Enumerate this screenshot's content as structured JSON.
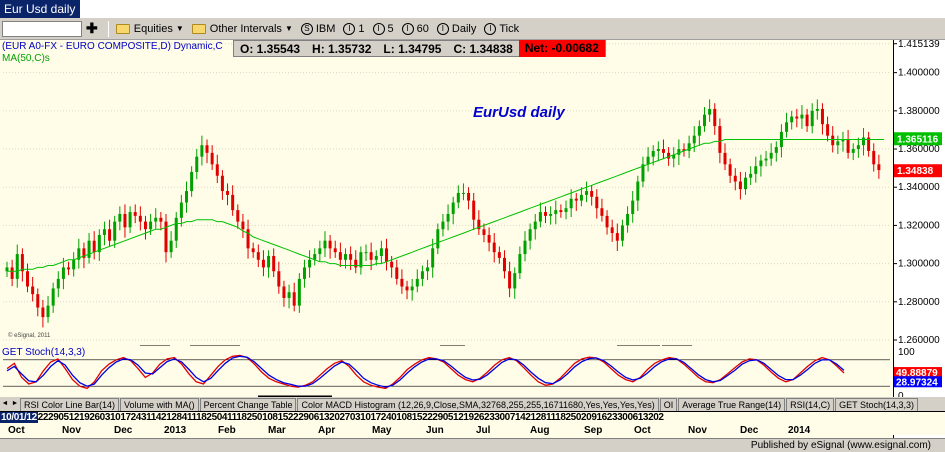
{
  "window": {
    "title": "Eur Usd daily"
  },
  "toolbar": {
    "symbol_placeholder": "",
    "equities_label": "Equities",
    "intervals_label": "Other Intervals",
    "interval_buttons": [
      "IBM",
      "1",
      "5",
      "60",
      "Daily",
      "Tick"
    ]
  },
  "quote": {
    "open": "O: 1.35543",
    "high": "H: 1.35732",
    "low": "L: 1.34795",
    "close": "C: 1.34838",
    "net": "Net: -0.00682"
  },
  "labels": {
    "symbol": "(EUR A0-FX - EURO COMPOSITE,D) Dynamic,C",
    "ma": "MA(50,C)s",
    "chart_title": "EurUsd daily",
    "credit": "© eSignal, 2011",
    "stoch": "GET Stoch(14,3,3)"
  },
  "tabs": [
    "RSI Color Line Bar(14)",
    "Volume with MA()",
    "Percent Change Table",
    "Color MACD Histogram (12,26,9,Close,SMA,32768,255,255,16711680,Yes,Yes,Yes,Yes)",
    "OI",
    "Average True Range(14)",
    "RSI(14,C)",
    "GET Stoch(14,3,3)"
  ],
  "dates": {
    "start": "10/01/12",
    "ticks": "22290512192603101724311421284111825041118250108152229061320270310172401081522290512192623300714212811182502091623300613202",
    "months": [
      "Oct",
      "Nov",
      "Dec",
      "2013",
      "Feb",
      "Mar",
      "Apr",
      "May",
      "Jun",
      "Jul",
      "Aug",
      "Sep",
      "Oct",
      "Nov",
      "Dec",
      "2014"
    ]
  },
  "status": {
    "publisher": "Published by eSignal (www.esignal.com)"
  },
  "colors": {
    "up": "#00a000",
    "down": "#e00000",
    "ma": "#00c000",
    "stoch_k": "#e00000",
    "stoch_d": "#0000e0",
    "net_bg": "#ff0000",
    "background": "#fffde8"
  },
  "chart_data": [
    {
      "type": "candlestick",
      "ylim": [
        1.26,
        1.415
      ],
      "y_ticks": [
        "1.415139",
        "1.400000",
        "1.380000",
        "1.360000",
        "1.340000",
        "1.320000",
        "1.300000",
        "1.280000",
        "1.260000"
      ],
      "y_tick_values": [
        1.415139,
        1.4,
        1.38,
        1.36,
        1.34,
        1.32,
        1.3,
        1.28,
        1.26
      ],
      "last_price": {
        "label": "1.34838",
        "value": 1.34838,
        "color": "#ff0000"
      },
      "ma_value": {
        "label": "1.365116",
        "value": 1.365116,
        "color": "#00c000"
      },
      "series_close": [
        1.298,
        1.292,
        1.305,
        1.296,
        1.288,
        1.284,
        1.277,
        1.272,
        1.278,
        1.287,
        1.292,
        1.298,
        1.297,
        1.302,
        1.308,
        1.303,
        1.312,
        1.306,
        1.315,
        1.318,
        1.312,
        1.322,
        1.326,
        1.319,
        1.327,
        1.325,
        1.322,
        1.318,
        1.322,
        1.324,
        1.322,
        1.306,
        1.312,
        1.324,
        1.332,
        1.338,
        1.348,
        1.356,
        1.362,
        1.358,
        1.352,
        1.346,
        1.338,
        1.336,
        1.328,
        1.322,
        1.318,
        1.308,
        1.306,
        1.302,
        1.298,
        1.304,
        1.296,
        1.288,
        1.282,
        1.285,
        1.278,
        1.292,
        1.298,
        1.302,
        1.305,
        1.308,
        1.312,
        1.308,
        1.306,
        1.302,
        1.305,
        1.302,
        1.298,
        1.306,
        1.306,
        1.302,
        1.304,
        1.308,
        1.301,
        1.298,
        1.292,
        1.288,
        1.286,
        1.288,
        1.292,
        1.296,
        1.298,
        1.308,
        1.318,
        1.322,
        1.326,
        1.332,
        1.337,
        1.337,
        1.333,
        1.323,
        1.318,
        1.315,
        1.311,
        1.306,
        1.303,
        1.296,
        1.287,
        1.295,
        1.305,
        1.312,
        1.318,
        1.322,
        1.327,
        1.325,
        1.326,
        1.328,
        1.327,
        1.329,
        1.334,
        1.333,
        1.336,
        1.338,
        1.335,
        1.329,
        1.325,
        1.319,
        1.316,
        1.312,
        1.32,
        1.326,
        1.333,
        1.343,
        1.352,
        1.356,
        1.359,
        1.36,
        1.358,
        1.355,
        1.357,
        1.36,
        1.359,
        1.363,
        1.367,
        1.372,
        1.378,
        1.381,
        1.372,
        1.358,
        1.352,
        1.346,
        1.343,
        1.339,
        1.345,
        1.347,
        1.351,
        1.354,
        1.355,
        1.358,
        1.361,
        1.369,
        1.374,
        1.377,
        1.376,
        1.378,
        1.372,
        1.38,
        1.381,
        1.373,
        1.367,
        1.362,
        1.364,
        1.365,
        1.358,
        1.36,
        1.362,
        1.366,
        1.359,
        1.352,
        1.349
      ],
      "ma50": [
        1.296,
        1.296,
        1.296,
        1.297,
        1.297,
        1.297,
        1.298,
        1.298,
        1.299,
        1.299,
        1.3,
        1.301,
        1.302,
        1.302,
        1.303,
        1.304,
        1.305,
        1.306,
        1.307,
        1.308,
        1.309,
        1.31,
        1.311,
        1.312,
        1.313,
        1.314,
        1.315,
        1.316,
        1.317,
        1.318,
        1.318,
        1.319,
        1.32,
        1.321,
        1.321,
        1.322,
        1.322,
        1.323,
        1.323,
        1.323,
        1.323,
        1.322,
        1.322,
        1.321,
        1.32,
        1.319,
        1.317,
        1.316,
        1.314,
        1.313,
        1.312,
        1.311,
        1.31,
        1.309,
        1.308,
        1.307,
        1.306,
        1.305,
        1.304,
        1.303,
        1.302,
        1.301,
        1.301,
        1.3,
        1.3,
        1.299,
        1.299,
        1.299,
        1.299,
        1.299,
        1.299,
        1.299,
        1.3,
        1.3,
        1.301,
        1.302,
        1.303,
        1.304,
        1.305,
        1.306,
        1.307,
        1.308,
        1.309,
        1.31,
        1.311,
        1.312,
        1.313,
        1.314,
        1.315,
        1.316,
        1.317,
        1.318,
        1.319,
        1.32,
        1.321,
        1.322,
        1.323,
        1.324,
        1.325,
        1.326,
        1.327,
        1.328,
        1.329,
        1.33,
        1.331,
        1.332,
        1.333,
        1.334,
        1.335,
        1.336,
        1.337,
        1.338,
        1.339,
        1.34,
        1.341,
        1.342,
        1.343,
        1.344,
        1.345,
        1.346,
        1.347,
        1.348,
        1.349,
        1.35,
        1.351,
        1.352,
        1.353,
        1.354,
        1.355,
        1.356,
        1.357,
        1.358,
        1.359,
        1.36,
        1.361,
        1.362,
        1.363,
        1.363,
        1.364,
        1.364,
        1.365,
        1.365,
        1.365,
        1.365,
        1.365,
        1.365,
        1.365,
        1.365,
        1.365,
        1.365,
        1.365,
        1.365,
        1.365,
        1.365,
        1.365,
        1.365,
        1.365,
        1.365,
        1.365,
        1.365,
        1.365,
        1.365,
        1.365,
        1.365,
        1.365,
        1.365,
        1.365,
        1.365,
        1.365,
        1.365,
        1.365,
        1.365
      ]
    },
    {
      "type": "line",
      "ylim": [
        0,
        100
      ],
      "y_ticks": [
        "100",
        "0"
      ],
      "y_tick_values": [
        100,
        0
      ],
      "readouts": [
        {
          "label": "49.88879",
          "value": 49.88879,
          "color": "#ff0000"
        },
        {
          "label": "28.97324",
          "value": 28.97324,
          "color": "#0000ff"
        }
      ],
      "series": [
        {
          "values": [
            60,
            72,
            40,
            25,
            30,
            55,
            75,
            82,
            60,
            35,
            20,
            15,
            30,
            55,
            70,
            80,
            85,
            78,
            60,
            40,
            50,
            70,
            82,
            85,
            70,
            48,
            30,
            25,
            45,
            65,
            80,
            88,
            90,
            85,
            70,
            52,
            38,
            30,
            25,
            20,
            18,
            22,
            30,
            45,
            60,
            72,
            78,
            65,
            45,
            30,
            22,
            18,
            15,
            25,
            40,
            58,
            70,
            80,
            85,
            82,
            75,
            60,
            45,
            35,
            30,
            38,
            52,
            68,
            80,
            85,
            78,
            62,
            45,
            30,
            22,
            25,
            38,
            55,
            72,
            82,
            86,
            84,
            75,
            60,
            45,
            35,
            30,
            40,
            58,
            72,
            80,
            85,
            82,
            70,
            55,
            40,
            30,
            28,
            35,
            48,
            62,
            75,
            82,
            80,
            68,
            52,
            38,
            30,
            35,
            50,
            65,
            78,
            85,
            80,
            66,
            50
          ]
        },
        {
          "values": [
            55,
            65,
            48,
            32,
            30,
            45,
            65,
            78,
            68,
            45,
            28,
            20,
            25,
            45,
            62,
            75,
            82,
            80,
            68,
            50,
            48,
            62,
            76,
            82,
            75,
            58,
            40,
            30,
            38,
            56,
            72,
            84,
            88,
            86,
            75,
            60,
            45,
            35,
            28,
            24,
            20,
            20,
            26,
            38,
            52,
            66,
            75,
            70,
            55,
            38,
            28,
            22,
            18,
            22,
            34,
            50,
            64,
            75,
            82,
            82,
            78,
            66,
            52,
            40,
            34,
            36,
            46,
            60,
            74,
            82,
            80,
            68,
            52,
            38,
            28,
            26,
            34,
            48,
            64,
            76,
            83,
            84,
            78,
            66,
            52,
            40,
            34,
            38,
            50,
            65,
            76,
            82,
            82,
            74,
            60,
            46,
            35,
            30,
            33,
            44,
            56,
            70,
            78,
            80,
            72,
            58,
            44,
            35,
            35,
            45,
            58,
            72,
            80,
            80,
            70,
            56
          ]
        }
      ]
    }
  ]
}
